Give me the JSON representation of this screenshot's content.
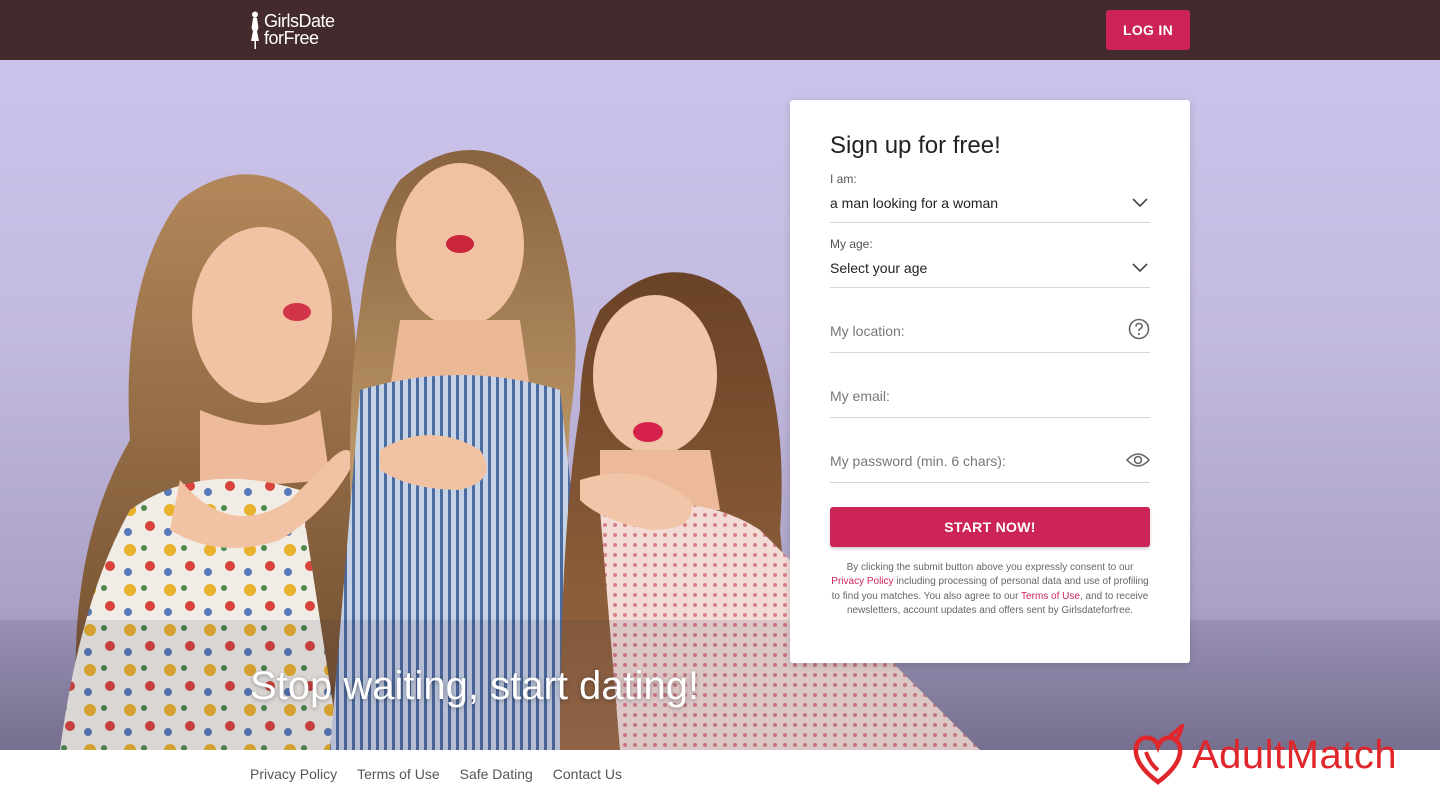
{
  "header": {
    "logo_line1": "GirlsDate",
    "logo_line2": "forFree",
    "login_label": "LOG IN"
  },
  "hero": {
    "headline": "Stop waiting, start dating!"
  },
  "signup": {
    "title": "Sign up for free!",
    "iam_label": "I am:",
    "iam_value": "a man looking for a woman",
    "age_label": "My age:",
    "age_value": "Select your age",
    "location_placeholder": "My location:",
    "email_placeholder": "My email:",
    "password_placeholder": "My password (min. 6 chars):",
    "submit_label": "START NOW!",
    "consent_part1": "By clicking the submit button above you expressly consent to our ",
    "privacy_link": "Privacy Policy",
    "consent_part2": " including processing of personal data and use of profiling to find you matches. You also agree to our ",
    "terms_link": "Terms of Use",
    "consent_part3": ", and to receive newsletters, account updates and offers sent by Girlsdateforfree."
  },
  "footer": {
    "links": [
      "Privacy Policy",
      "Terms of Use",
      "Safe Dating",
      "Contact Us"
    ]
  },
  "watermark": {
    "text": "AdultMatch"
  },
  "icons": {
    "chevron": "chevron-down-icon",
    "help": "question-circle-icon",
    "eye": "eye-icon",
    "logo": "woman-silhouette-icon",
    "watermark": "devil-heart-icon"
  },
  "colors": {
    "header_bg": "#432b2d",
    "accent": "#cc2456",
    "watermark": "#e0262b"
  }
}
